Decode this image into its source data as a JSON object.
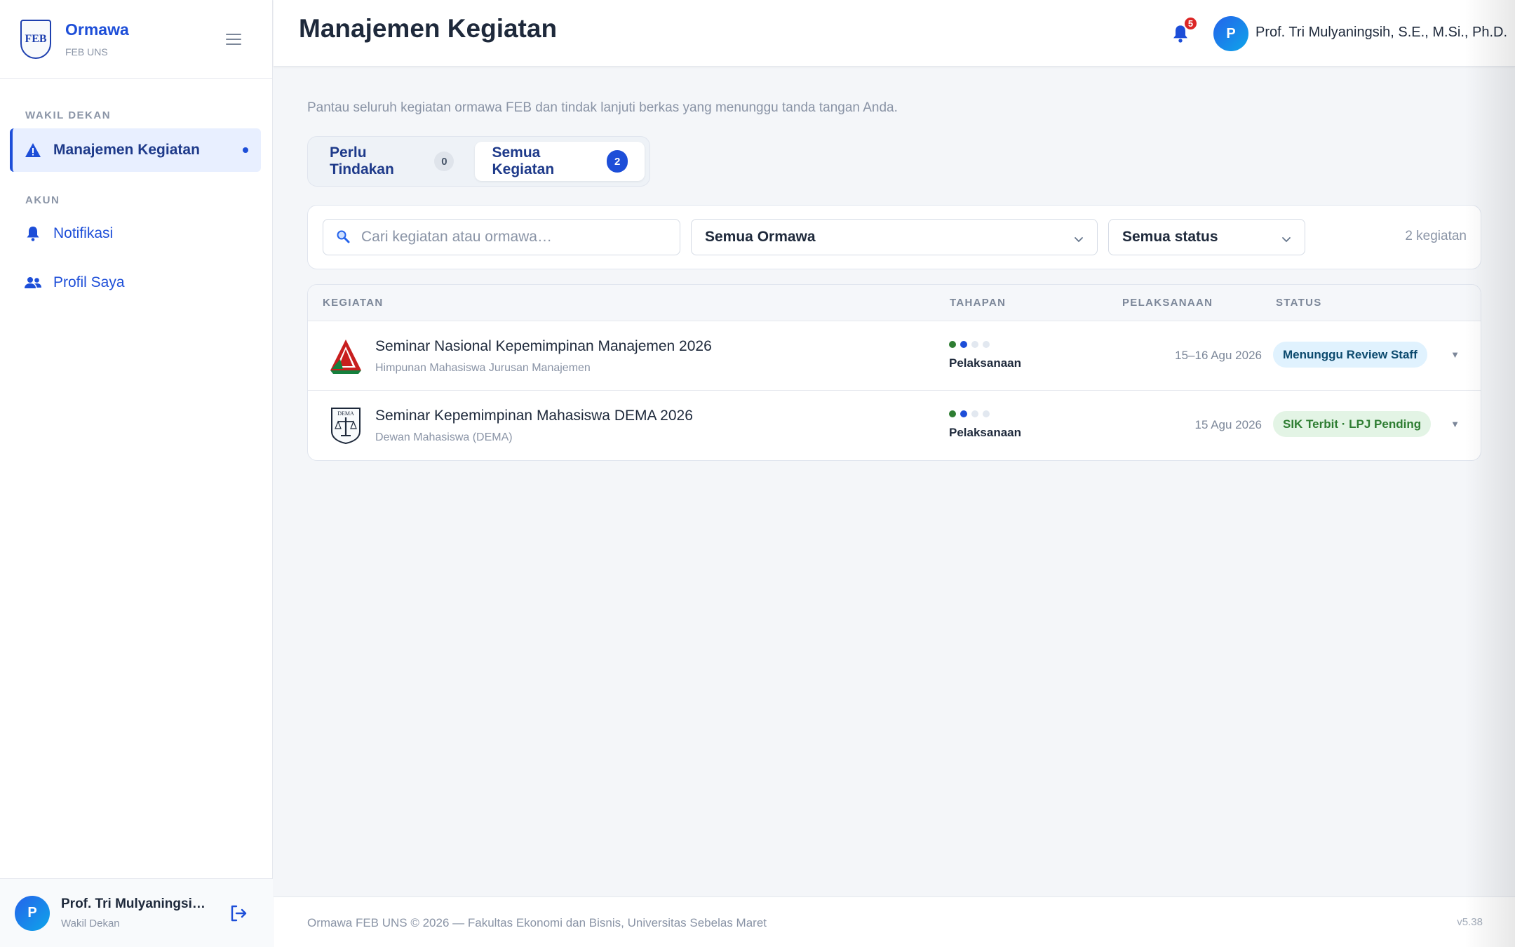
{
  "brand": {
    "title": "Ormawa",
    "subtitle": "FEB UNS",
    "logo_text": "FEB"
  },
  "sidebar": {
    "sections": [
      {
        "label": "WAKIL DEKAN"
      },
      {
        "label": "AKUN"
      }
    ],
    "items": [
      {
        "label": "Manajemen Kegiatan",
        "icon": "warning-triangle-icon",
        "active": true
      },
      {
        "label": "Notifikasi",
        "icon": "bell-icon"
      },
      {
        "label": "Profil Saya",
        "icon": "users-icon"
      }
    ],
    "footer": {
      "name": "Prof. Tri Mulyaningsih, ...",
      "role": "Wakil Dekan",
      "avatar_initial": "P"
    }
  },
  "header": {
    "title": "Manajemen Kegiatan",
    "notification_count": "5",
    "user_name": "Prof. Tri Mulyaningsih, S.E., M.Si., Ph.D.",
    "avatar_initial": "P"
  },
  "main": {
    "subtitle": "Pantau seluruh kegiatan ormawa FEB dan tindak lanjuti berkas yang menunggu tanda tangan Anda.",
    "tabs": [
      {
        "label": "Perlu Tindakan",
        "count": "0",
        "active": false
      },
      {
        "label": "Semua Kegiatan",
        "count": "2",
        "active": true
      }
    ],
    "filters": {
      "search_placeholder": "Cari kegiatan atau ormawa…",
      "search_value": "",
      "ormawa_selected": "Semua Ormawa",
      "status_selected": "Semua status",
      "result_count": "2 kegiatan"
    },
    "table": {
      "columns": [
        "KEGIATAN",
        "TAHAPAN",
        "PELAKSANAAN",
        "STATUS"
      ],
      "rows": [
        {
          "title": "Seminar Nasional Kepemimpinan Manajemen 2026",
          "org": "Himpunan Mahasiswa Jurusan Manajemen",
          "stage": "Pelaksanaan",
          "stage_steps": [
            "done",
            "current",
            "todo",
            "todo"
          ],
          "date": "15–16 Agu 2026",
          "status": "Menunggu Review Staff",
          "status_tone": "blue"
        },
        {
          "title": "Seminar Kepemimpinan Mahasiswa DEMA 2026",
          "org": "Dewan Mahasiswa (DEMA)",
          "stage": "Pelaksanaan",
          "stage_steps": [
            "done",
            "current",
            "todo",
            "todo"
          ],
          "date": "15 Agu 2026",
          "status": "SIK Terbit · LPJ Pending",
          "status_tone": "green"
        }
      ]
    }
  },
  "footer": {
    "copyright": "Ormawa FEB UNS © 2026 — Fakultas Ekonomi dan Bisnis, Universitas Sebelas Maret",
    "version": "v5.38"
  },
  "colors": {
    "primary": "#1d4ed8",
    "danger": "#dc2626",
    "success": "#2e7d32",
    "info_bg": "#e0f2fe"
  }
}
